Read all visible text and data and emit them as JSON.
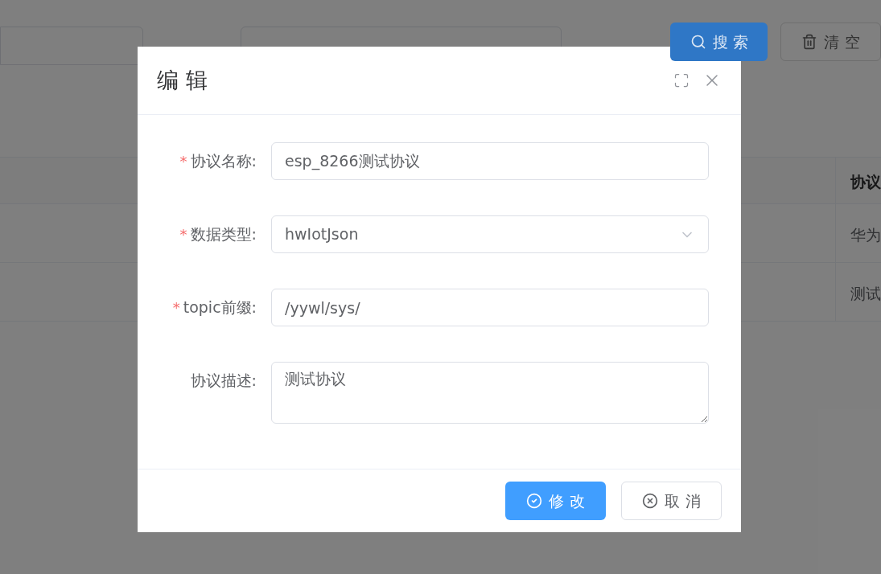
{
  "background": {
    "buttons": [
      {
        "kind": "search",
        "label": "搜 索"
      },
      {
        "kind": "clear",
        "label": "清 空"
      }
    ],
    "table": {
      "header": "协议",
      "rows": [
        "华为",
        "测试"
      ]
    }
  },
  "dialog": {
    "title": "编 辑",
    "required_mark": "*",
    "fields": [
      {
        "kind": "input",
        "required": true,
        "label": "协议名称:",
        "value": "esp_8266测试协议"
      },
      {
        "kind": "select",
        "required": true,
        "label": "数据类型:",
        "value": "hwIotJson"
      },
      {
        "kind": "input",
        "required": true,
        "label": "topic前缀:",
        "value": "/yywl/sys/"
      },
      {
        "kind": "textarea",
        "required": false,
        "label": "协议描述:",
        "value": "测试协议"
      }
    ],
    "buttons": [
      {
        "kind": "primary",
        "label": "修 改"
      },
      {
        "kind": "cancel",
        "label": "取 消"
      }
    ]
  }
}
